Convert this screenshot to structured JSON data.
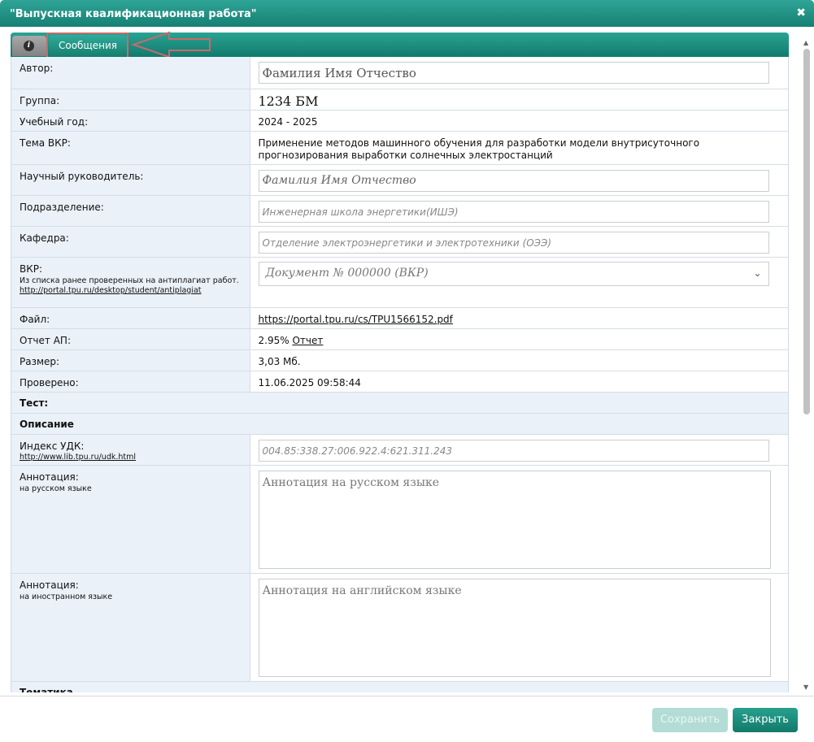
{
  "window": {
    "title": "\"Выпускная квалификационная работа\"",
    "close_glyph": "✖"
  },
  "tabs": {
    "info_glyph": "i",
    "messages": "Сообщения"
  },
  "form": {
    "author": {
      "label": "Автор:",
      "value": "Фамилия Имя Отчество"
    },
    "group": {
      "label": "Группа:",
      "value": "1234 БМ"
    },
    "year": {
      "label": "Учебный год:",
      "value": "2024 - 2025"
    },
    "topic": {
      "label": "Тема ВКР:",
      "value": "Применение методов машинного обучения для разработки модели внутрисуточного прогнозирования выработки солнечных электростанций"
    },
    "supervisor": {
      "label": "Научный руководитель:",
      "value": "Фамилия Имя Отчество"
    },
    "division": {
      "label": "Подразделение:",
      "value": "Инженерная школа энергетики(ИШЭ)"
    },
    "department": {
      "label": "Кафедра:",
      "value": "Отделение электроэнергетики и электротехники (ОЭЭ)"
    },
    "vkr": {
      "label": "ВКР:",
      "hint": "Из списка ранее проверенных на антиплагиат работ.",
      "link": "http://portal.tpu.ru/desktop/student/antiplagiat",
      "selected": "Документ № 000000 (ВКР)"
    },
    "file": {
      "label": "Файл:",
      "value": "https://portal.tpu.ru/cs/TPU1566152.pdf"
    },
    "report": {
      "label": "Отчет АП:",
      "percent": "2.95%",
      "link": "Отчет"
    },
    "size": {
      "label": "Размер:",
      "value": "3,03 Мб."
    },
    "checked": {
      "label": "Проверено:",
      "value": "11.06.2025 09:58:44"
    },
    "test_header": "Тест:",
    "description_header": "Описание",
    "udk": {
      "label": "Индекс УДК:",
      "link": "http://www.lib.tpu.ru/udk.html",
      "placeholder": "004.85:338.27:006.922.4:621.311.243"
    },
    "annotation_ru": {
      "label": "Аннотация:",
      "sub": "на русском языке",
      "placeholder": "Аннотация на русском языке"
    },
    "annotation_en": {
      "label": "Аннотация:",
      "sub": "на иностранном языке",
      "placeholder": "Аннотация на английском языке"
    },
    "topics_header": "Тематика"
  },
  "footer": {
    "save": "Сохранить",
    "close": "Закрыть"
  },
  "colors": {
    "accent": "#158073",
    "label_bg": "#eaf1f9",
    "annotation": "#c96a6a"
  }
}
